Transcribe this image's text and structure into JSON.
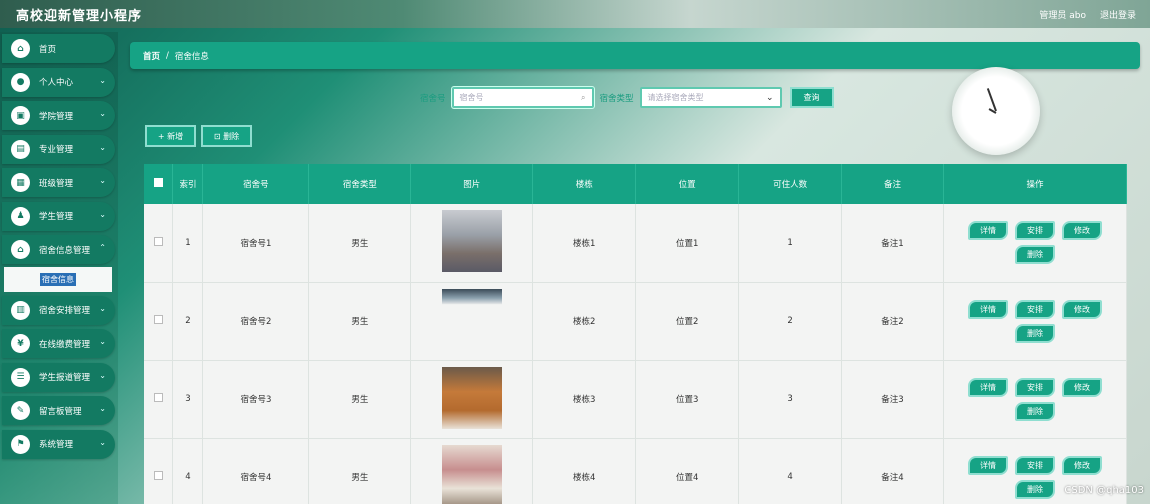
{
  "app": {
    "title": "高校迎新管理小程序"
  },
  "top_right": {
    "user": "管理员 abo",
    "logout": "退出登录"
  },
  "sidebar": {
    "items": [
      {
        "label": "首页",
        "icon": "home-icon",
        "glyph": "⌂"
      },
      {
        "label": "个人中心",
        "icon": "user-icon",
        "glyph": "●"
      },
      {
        "label": "学院管理",
        "icon": "college-icon",
        "glyph": "▣"
      },
      {
        "label": "专业管理",
        "icon": "major-icon",
        "glyph": "▤"
      },
      {
        "label": "班级管理",
        "icon": "class-icon",
        "glyph": "▦"
      },
      {
        "label": "学生管理",
        "icon": "student-icon",
        "glyph": "♟"
      },
      {
        "label": "宿舍信息管理",
        "icon": "dorm-icon",
        "glyph": "⌂"
      },
      {
        "label": "宿舍安排管理",
        "icon": "arrange-icon",
        "glyph": "▥"
      },
      {
        "label": "在线缴费管理",
        "icon": "payment-icon",
        "glyph": "¥"
      },
      {
        "label": "学生报道管理",
        "icon": "report-icon",
        "glyph": "☰"
      },
      {
        "label": "留言板管理",
        "icon": "message-icon",
        "glyph": "✎"
      },
      {
        "label": "系统管理",
        "icon": "system-icon",
        "glyph": "⚑"
      }
    ],
    "sub_active": "宿舍信息"
  },
  "breadcrumb": {
    "home": "首页",
    "separator": "/",
    "current": "宿舍信息"
  },
  "search": {
    "dorm_label": "宿舍号",
    "dorm_placeholder": "宿舍号",
    "type_label": "宿舍类型",
    "type_placeholder": "请选择宿舍类型",
    "query": "查询"
  },
  "actions": {
    "add": "+ 新增",
    "delete": "⊡ 删除"
  },
  "table": {
    "headers": [
      "",
      "索引",
      "宿舍号",
      "宿舍类型",
      "图片",
      "楼栋",
      "位置",
      "可住人数",
      "备注",
      "操作"
    ],
    "rows": [
      {
        "index": "1",
        "dorm": "宿舍号1",
        "type": "男生",
        "building": "楼栋1",
        "position": "位置1",
        "capacity": "1",
        "note": "备注1"
      },
      {
        "index": "2",
        "dorm": "宿舍号2",
        "type": "男生",
        "building": "楼栋2",
        "position": "位置2",
        "capacity": "2",
        "note": "备注2"
      },
      {
        "index": "3",
        "dorm": "宿舍号3",
        "type": "男生",
        "building": "楼栋3",
        "position": "位置3",
        "capacity": "3",
        "note": "备注3"
      },
      {
        "index": "4",
        "dorm": "宿舍号4",
        "type": "男生",
        "building": "楼栋4",
        "position": "位置4",
        "capacity": "4",
        "note": "备注4"
      }
    ],
    "ops": {
      "detail": "详情",
      "arrange": "安排",
      "edit": "修改",
      "remove": "删除"
    }
  },
  "watermark": "CSDN @qha103",
  "colors": {
    "primary": "#16a385",
    "sidebar": "#137a62"
  }
}
